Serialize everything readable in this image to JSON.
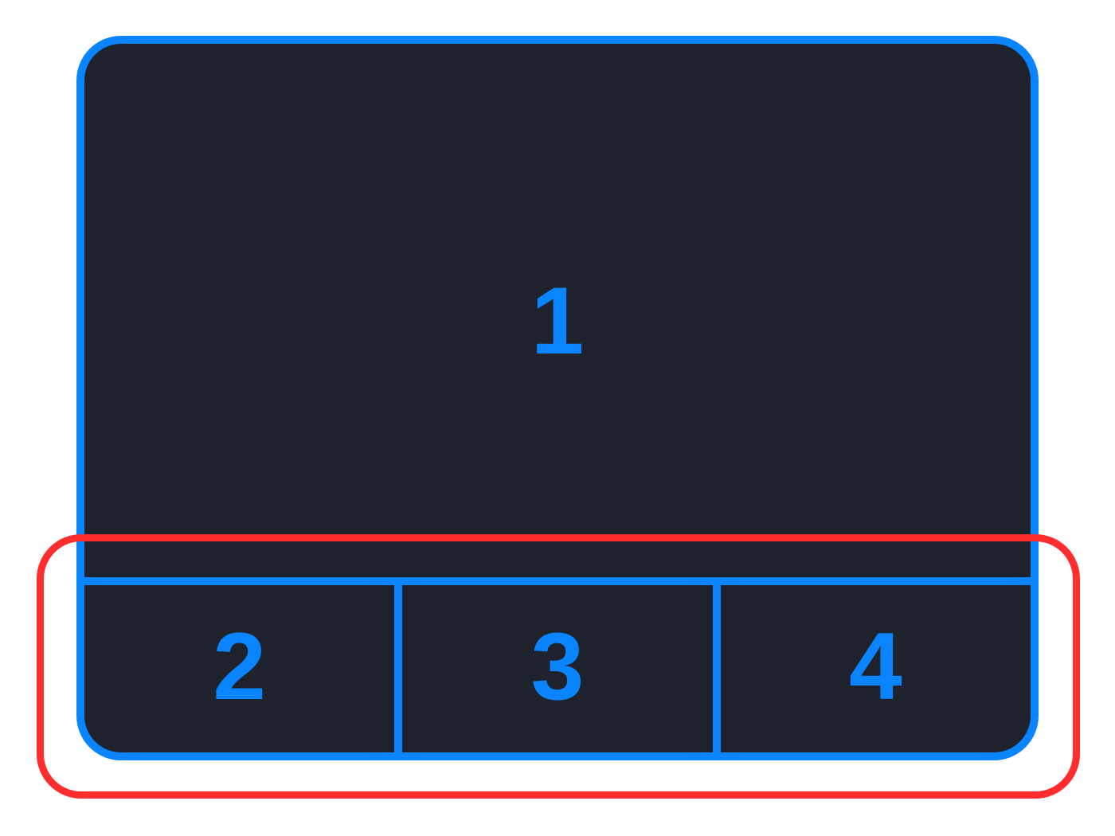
{
  "colors": {
    "accent": "#0a84ff",
    "panel_background": "#1d222d",
    "highlight": "#ff2d2d",
    "page_background": "#ffffff"
  },
  "panes": {
    "top": "1",
    "bottom": [
      "2",
      "3",
      "4"
    ]
  }
}
